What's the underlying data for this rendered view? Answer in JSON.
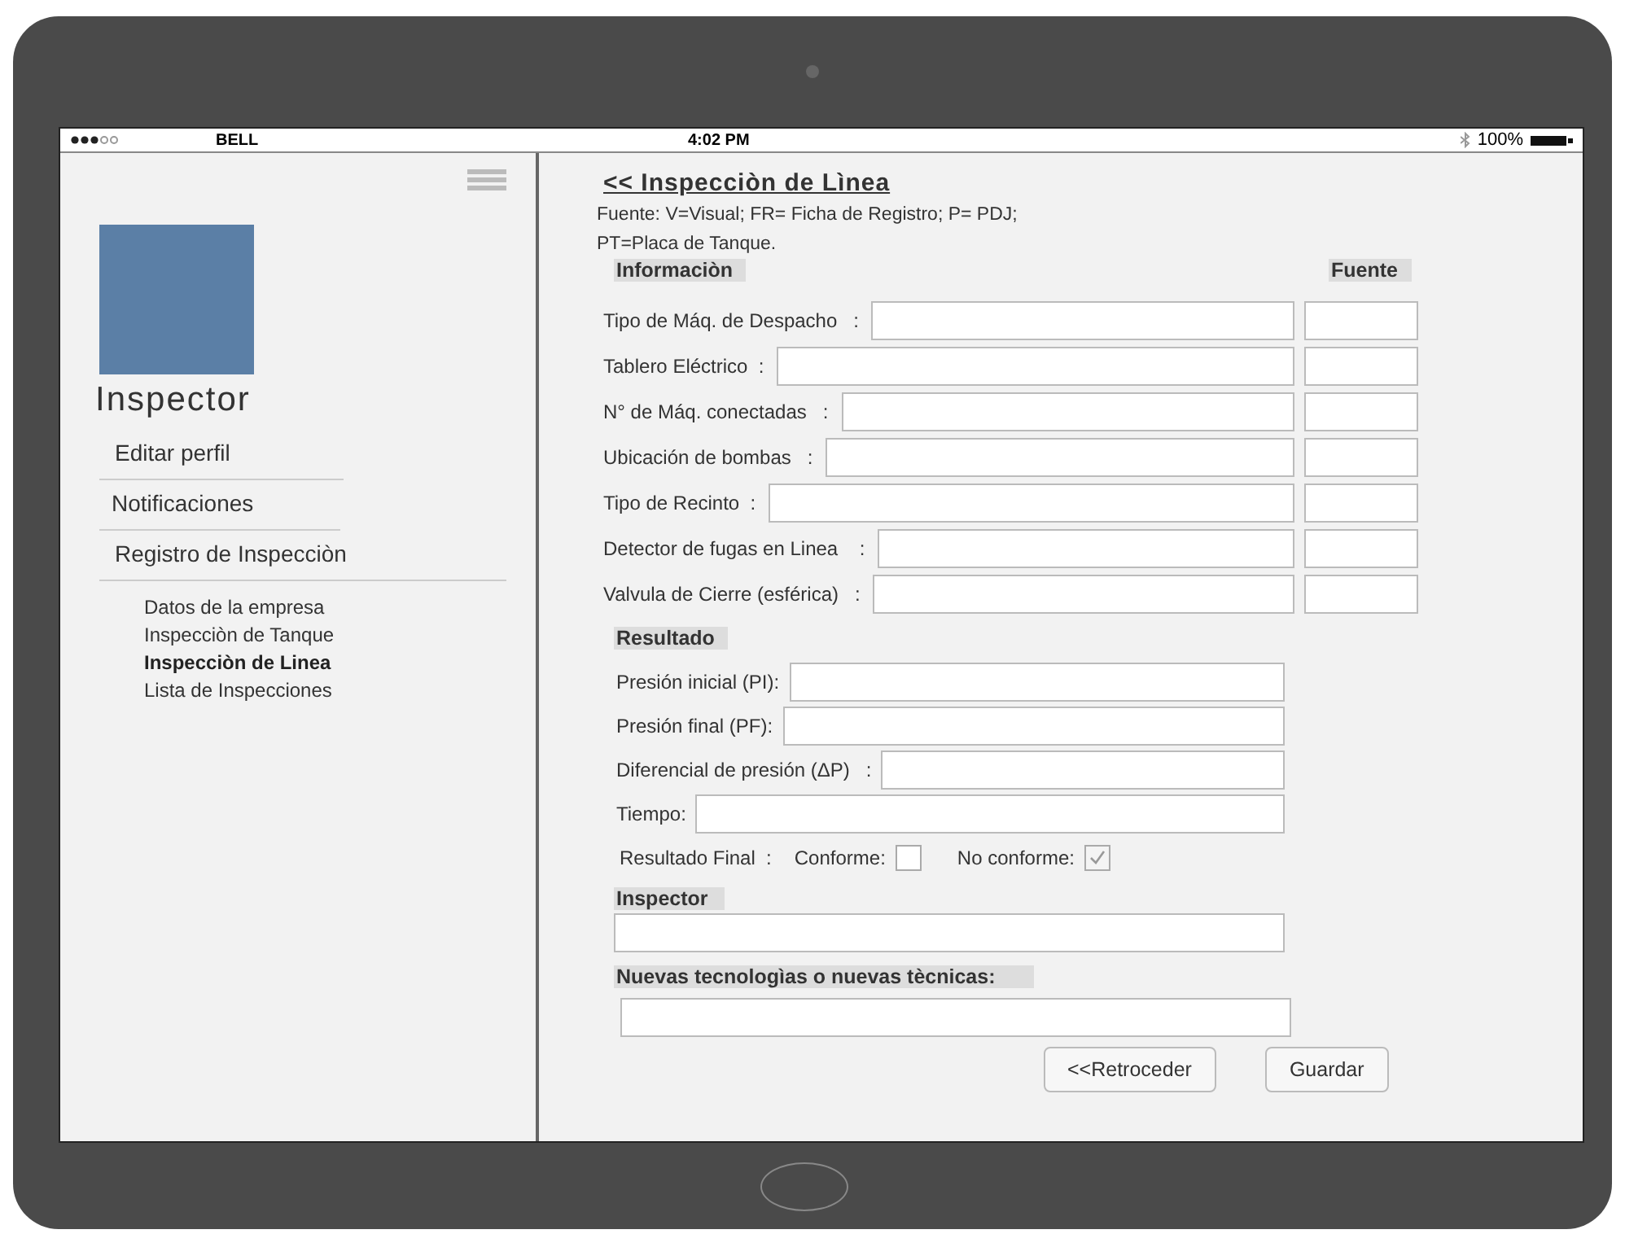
{
  "status_bar": {
    "carrier": "BELL",
    "time": "4:02 PM",
    "battery": "100%"
  },
  "sidebar": {
    "profile_name": "Inspector",
    "menu": [
      {
        "label": "Editar perfil"
      },
      {
        "label": "Notificaciones"
      },
      {
        "label": "Registro de Inspecciòn"
      }
    ],
    "submenu": [
      {
        "label": "Datos de la empresa",
        "selected": false
      },
      {
        "label": "Inspecciòn de Tanque",
        "selected": false
      },
      {
        "label": "Inspecciòn de Linea",
        "selected": true
      },
      {
        "label": "Lista de Inspecciones",
        "selected": false
      }
    ]
  },
  "form": {
    "title": "<< Inspecciòn de Lìnea",
    "legend": [
      "Fuente: V=Visual; FR= Ficha de Registro; P= PDJ;",
      "PT=Placa de Tanque."
    ],
    "info_header": "Informaciòn",
    "source_header": "Fuente",
    "info_rows": [
      {
        "label": "Tipo de Máq. de Despacho   :"
      },
      {
        "label": "Tablero Eléctrico  :"
      },
      {
        "label": "N° de Máq. conectadas   :"
      },
      {
        "label": "Ubicación de bombas   :"
      },
      {
        "label": "Tipo de Recinto  :"
      },
      {
        "label": "Detector de fugas en Linea    :"
      },
      {
        "label": "Valvula de Cierre (esférica)   :"
      }
    ],
    "result_header": "Resultado",
    "result_rows": [
      {
        "label": "Presión inicial (PI):"
      },
      {
        "label": "Presión final (PF):"
      },
      {
        "label": "Diferencial de presión (ΔP)   :"
      },
      {
        "label": "Tiempo:"
      }
    ],
    "final": {
      "label": "Resultado Final  :",
      "options": [
        {
          "label": "Conforme:",
          "checked": false
        },
        {
          "label": "No conforme:",
          "checked": true
        }
      ]
    },
    "inspector_label": "Inspector",
    "tech_label": "Nuevas tecnologìas o nuevas tècnicas:",
    "buttons": [
      {
        "label": "<<Retroceder"
      },
      {
        "label": "Guardar"
      }
    ]
  }
}
